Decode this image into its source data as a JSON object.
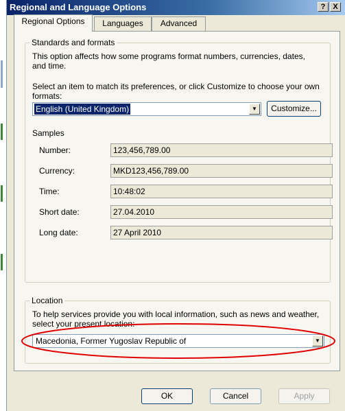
{
  "window": {
    "title": "Regional and Language Options",
    "help_button": "?",
    "close_button": "X"
  },
  "tabs": [
    {
      "label": "Regional Options",
      "active": true
    },
    {
      "label": "Languages",
      "active": false
    },
    {
      "label": "Advanced",
      "active": false
    }
  ],
  "standards": {
    "legend": "Standards and formats",
    "description": "This option affects how some programs format numbers, currencies, dates, and time.",
    "prompt": "Select an item to match its preferences, or click Customize to choose your own formats:",
    "selected_format": "English (United Kingdom)",
    "customize_label": "Customize...",
    "samples_heading": "Samples",
    "samples": [
      {
        "label": "Number:",
        "value": "123,456,789.00"
      },
      {
        "label": "Currency:",
        "value": "MKD123,456,789.00"
      },
      {
        "label": "Time:",
        "value": "10:48:02"
      },
      {
        "label": "Short date:",
        "value": "27.04.2010"
      },
      {
        "label": "Long date:",
        "value": "27 April 2010"
      }
    ]
  },
  "location": {
    "legend": "Location",
    "description": "To help services provide you with local information, such as news and weather, select your present location:",
    "selected_location": "Macedonia, Former Yugoslav Republic of"
  },
  "buttons": {
    "ok": "OK",
    "cancel": "Cancel",
    "apply": "Apply"
  },
  "colors": {
    "selection": "#0a246a",
    "highlight_annotation": "#e00000"
  }
}
